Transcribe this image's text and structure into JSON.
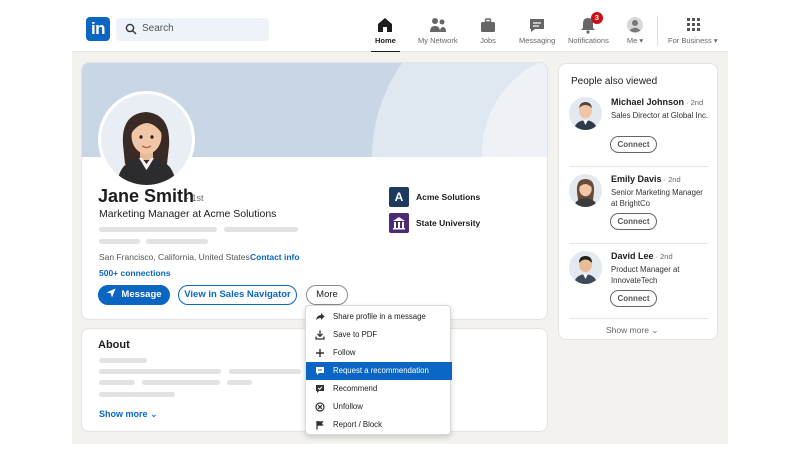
{
  "nav": {
    "logo_text": "in",
    "search_placeholder": "Search",
    "items": [
      {
        "label": "Home",
        "icon": "home-icon",
        "active": true
      },
      {
        "label": "My Network",
        "icon": "network-icon"
      },
      {
        "label": "Jobs",
        "icon": "briefcase-icon"
      },
      {
        "label": "Messaging",
        "icon": "message-icon"
      },
      {
        "label": "Notifications",
        "icon": "bell-icon",
        "badge": "3"
      },
      {
        "label": "Me ▾",
        "icon": "avatar-icon"
      },
      {
        "label": "For Business ▾",
        "icon": "grid-icon"
      }
    ]
  },
  "profile": {
    "name": "Jane Smith",
    "degree": "· 1st",
    "headline": "Marketing Manager at Acme Solutions",
    "location": "San Francisco, California, United States",
    "contact_info": "Contact info",
    "connections": "500+ connections",
    "orgs": [
      {
        "name": "Acme Solutions",
        "logo_text": "A",
        "color": "#1f3a5f"
      },
      {
        "name": "State University",
        "logo_text": "🏛",
        "color": "#4b2a78"
      }
    ],
    "buttons": {
      "message": "Message",
      "sales_nav": "View in Sales Navigator",
      "more": "More"
    }
  },
  "about": {
    "title": "About",
    "show_more": "Show more ⌄"
  },
  "dropdown": {
    "items": [
      {
        "label": "Share profile in a message",
        "icon": "share-icon"
      },
      {
        "label": "Save to PDF",
        "icon": "download-icon"
      },
      {
        "label": "Follow",
        "icon": "plus-icon"
      },
      {
        "label": "Request a recommendation",
        "icon": "chat-bubble-icon",
        "selected": true
      },
      {
        "label": "Recommend",
        "icon": "recommend-icon"
      },
      {
        "label": "Unfollow",
        "icon": "unfollow-icon"
      },
      {
        "label": "Report / Block",
        "icon": "flag-icon"
      }
    ]
  },
  "sidebar": {
    "title": "People also viewed",
    "people": [
      {
        "name": "Michael Johnson",
        "degree": "· 2nd",
        "title": "Sales Director at Global Inc.",
        "connect": "Connect"
      },
      {
        "name": "Emily Davis",
        "degree": "· 2nd",
        "title": "Senior Marketing Manager at BrightCo",
        "connect": "Connect"
      },
      {
        "name": "David Lee",
        "degree": "· 2nd",
        "title": "Product Manager at InnovateTech",
        "connect": "Connect"
      }
    ],
    "show_more": "Show more ⌄"
  },
  "colors": {
    "brand": "#0a66c2",
    "badge": "#cc1016",
    "selected_menu": "#0a66c2"
  }
}
